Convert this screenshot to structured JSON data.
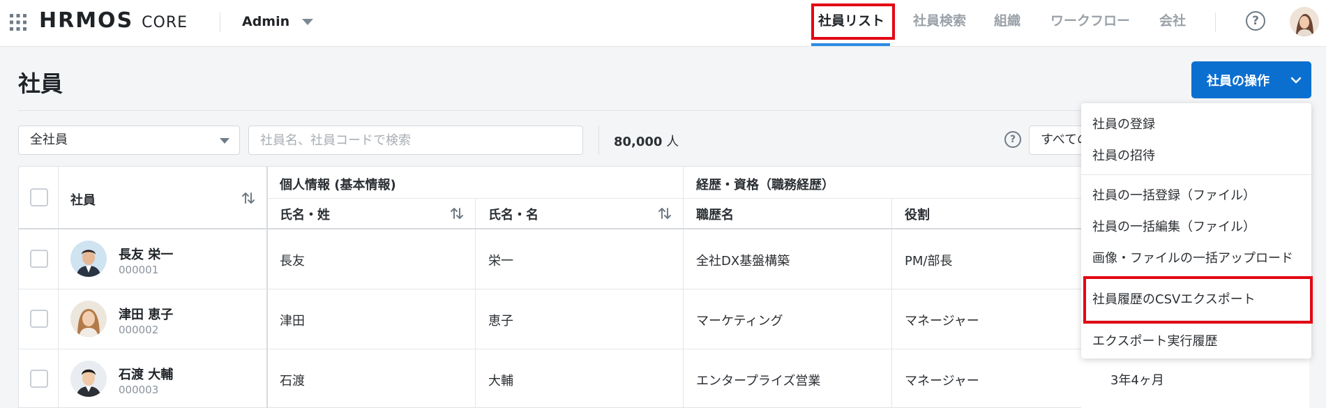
{
  "header": {
    "logo_word": "HRMOS",
    "logo_product": "CORE",
    "account": "Admin",
    "nav": [
      {
        "label": "社員リスト",
        "active": true
      },
      {
        "label": "社員検索",
        "active": false
      },
      {
        "label": "組織",
        "active": false
      },
      {
        "label": "ワークフロー",
        "active": false
      },
      {
        "label": "会社",
        "active": false
      }
    ],
    "help_glyph": "?"
  },
  "page": {
    "title": "社員",
    "ops_button_label": "社員の操作"
  },
  "toolbar": {
    "scope_select": "全社員",
    "search_placeholder": "社員名、社員コードで検索",
    "count_number": "80,000",
    "count_unit": " 人",
    "filter_select": "すべての"
  },
  "table": {
    "col_employee": "社員",
    "group_personal": "個人情報 (基本情報)",
    "group_career": "経歴・資格（職務経歴）",
    "col_last_name": "氏名・姓",
    "col_first_name": "氏名・名",
    "col_job_title": "職歴名",
    "col_role": "役割",
    "rows": [
      {
        "name": "長友 栄一",
        "code": "000001",
        "last": "長友",
        "first": "栄一",
        "job": "全社DX基盤構築",
        "role": "PM/部長",
        "extra": ""
      },
      {
        "name": "津田 恵子",
        "code": "000002",
        "last": "津田",
        "first": "恵子",
        "job": "マーケティング",
        "role": "マネージャー",
        "extra": ""
      },
      {
        "name": "石渡 大輔",
        "code": "000003",
        "last": "石渡",
        "first": "大輔",
        "job": "エンタープライズ営業",
        "role": "マネージャー",
        "extra": "3年4ヶ月"
      }
    ]
  },
  "menu": {
    "items": [
      "社員の登録",
      "社員の招待",
      "社員の一括登録（ファイル）",
      "社員の一括編集（ファイル）",
      "画像・ファイルの一括アップロード",
      "社員履歴のCSVエクスポート",
      "エクスポート実行履歴"
    ]
  },
  "colors": {
    "primary": "#0b6fd0",
    "nav_underline": "#2c8be5",
    "highlight": "#e30613"
  }
}
